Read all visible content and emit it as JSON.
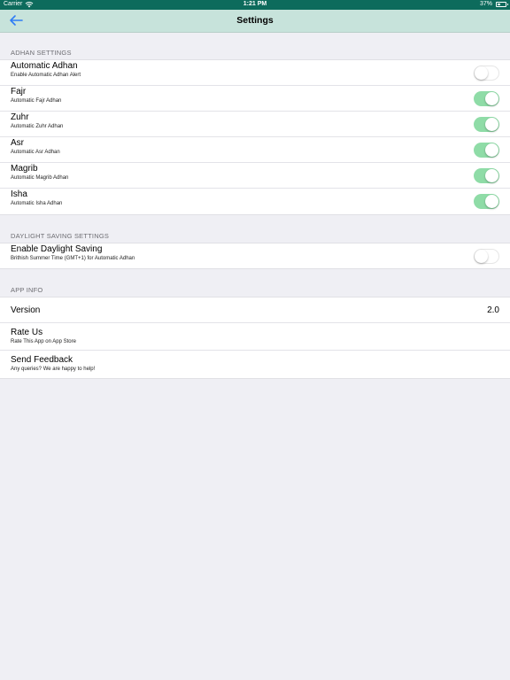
{
  "status_bar": {
    "carrier": "Carrier",
    "time": "1:21 PM",
    "battery": "37%",
    "battery_level": 0.37
  },
  "nav": {
    "title": "Settings",
    "back_icon": "arrow-left-icon",
    "accent_color": "#2f7cf6",
    "bar_color": "#c7e3db",
    "status_color": "#0d6b5c"
  },
  "adhan": {
    "header": "ADHAN SETTINGS",
    "rows": [
      {
        "label": "Automatic Adhan",
        "sublabel": "Enable Automatic Adhan Alert",
        "on": false
      },
      {
        "label": "Fajr",
        "sublabel": "Automatic Fajr Adhan",
        "on": true
      },
      {
        "label": "Zuhr",
        "sublabel": "Automatic Zuhr Adhan",
        "on": true
      },
      {
        "label": "Asr",
        "sublabel": "Automatic Asr Adhan",
        "on": true
      },
      {
        "label": "Magrib",
        "sublabel": "Automatic Magrib Adhan",
        "on": true
      },
      {
        "label": "Isha",
        "sublabel": "Automatic Isha Adhan",
        "on": true
      }
    ]
  },
  "daylight": {
    "header": "DAYLIGHT SAVING SETTINGS",
    "row": {
      "label": "Enable Daylight Saving",
      "sublabel": "Brithish Summer Time (GMT+1) for Automatic Adhan",
      "on": false
    }
  },
  "app_info": {
    "header": "APP INFO",
    "version_label": "Version",
    "version_value": "2.0",
    "rate": {
      "label": "Rate Us",
      "sublabel": "Rate This App on App Store"
    },
    "feedback": {
      "label": "Send Feedback",
      "sublabel": "Any queries? We are happy to help!"
    }
  },
  "toggle_colors": {
    "on": "#8fdca7",
    "off": "#ffffff"
  }
}
